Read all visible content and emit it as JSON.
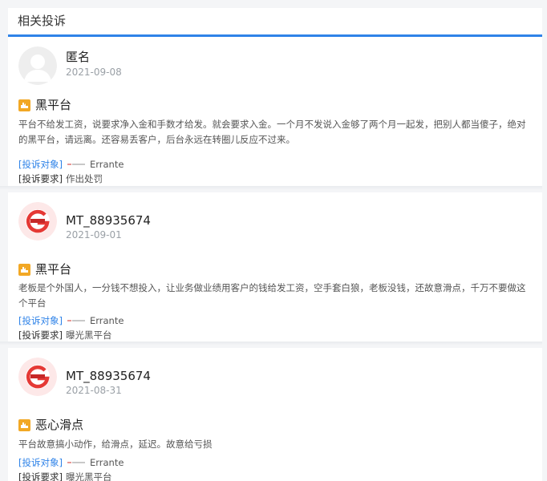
{
  "section": {
    "title": "相关投诉"
  },
  "labels": {
    "target": "[投诉对象]",
    "demand": "[投诉要求]"
  },
  "complaints": [
    {
      "user": "匿名",
      "date": "2021-09-08",
      "avatar_icon": "anonymous-avatar-icon",
      "title": "黑平台",
      "content": "平台不给发工资，说要求净入金和手数才给发。就会要求入金。一个月不发说入金够了两个月一起发，把别人都当傻子，绝对的黑平台，请远离。还容易丢客户，后台永远在转圈儿反应不过来。",
      "target": "Errante",
      "demand": "作出处罚"
    },
    {
      "user": "MT_88935674",
      "date": "2021-09-01",
      "avatar_icon": "user-logo-avatar-icon",
      "title": "黑平台",
      "content": "老板是个外国人，一分钱不想投入，让业务做业绩用客户的钱给发工资，空手套白狼，老板没钱，还故意滑点，千万不要做这个平台",
      "target": "Errante",
      "demand": "曝光黑平台"
    },
    {
      "user": "MT_88935674",
      "date": "2021-08-31",
      "avatar_icon": "user-logo-avatar-icon",
      "title": "恶心滑点",
      "content": "平台故意搞小动作，给滑点，延迟。故意给亏损",
      "target": "Errante",
      "demand": "曝光黑平台"
    }
  ],
  "colors": {
    "accent": "#2f83e8",
    "hot_badge": "#f2a825",
    "avatar_red": "#e53935"
  }
}
